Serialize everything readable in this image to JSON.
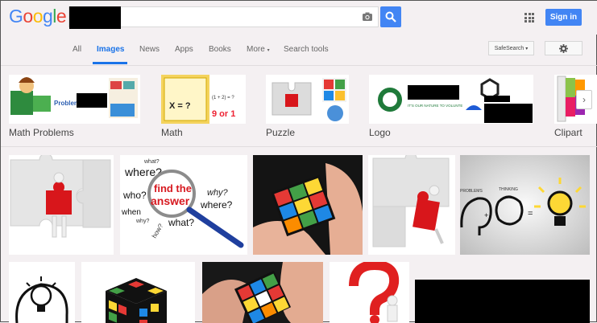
{
  "header": {
    "logo": [
      "G",
      "o",
      "o",
      "g",
      "l",
      "e"
    ],
    "logo_colors": [
      "#4285f4",
      "#ea4335",
      "#fbbc05",
      "#4285f4",
      "#34a853",
      "#ea4335"
    ],
    "signin_label": "Sign in"
  },
  "tabs": {
    "all": "All",
    "images": "Images",
    "news": "News",
    "apps": "Apps",
    "books": "Books",
    "more": "More",
    "search_tools": "Search tools"
  },
  "toolbar": {
    "safesearch_label": "SafeSearch"
  },
  "related": [
    {
      "label": "Math Problems"
    },
    {
      "label": "Math"
    },
    {
      "label": "Puzzle"
    },
    {
      "label": "Logo"
    },
    {
      "label": "Clipart"
    }
  ],
  "thumb_text": {
    "math_problem": "Problem",
    "math_eq": "X = ?",
    "math_nums": "9 or 1",
    "math_formula": "(1 + 2) = ?",
    "logo_tagline": "IT'S OUR NATURE TO VOLUNTEER",
    "where": "where?",
    "who": "who?",
    "when": "when",
    "why": "why?",
    "what": "what?",
    "how": "how?",
    "find_the": "find the",
    "answer": "answer",
    "problems": "PROBLEMS",
    "thinking": "THINKING"
  },
  "colors": {
    "accent": "#4285f4",
    "active_tab": "#1a73e8",
    "background": "#f4f0f2"
  }
}
